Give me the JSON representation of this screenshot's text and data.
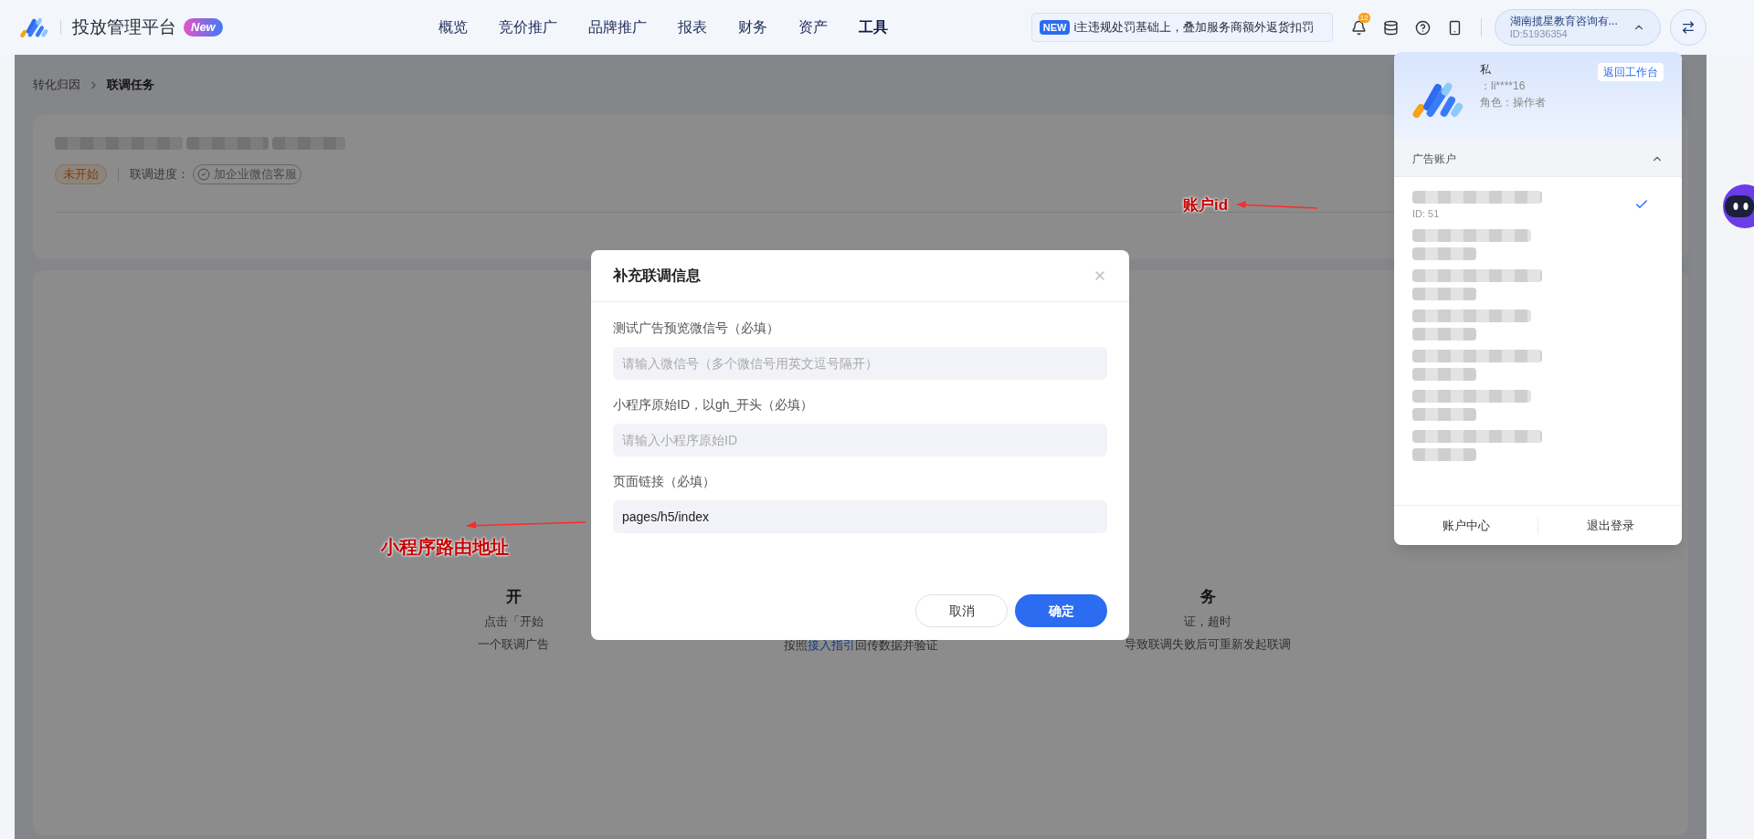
{
  "header": {
    "title": "投放管理平台",
    "badge": "New",
    "nav": [
      {
        "label": "概览",
        "selected": false
      },
      {
        "label": "竞价推广",
        "selected": false
      },
      {
        "label": "品牌推广",
        "selected": false
      },
      {
        "label": "报表",
        "selected": false
      },
      {
        "label": "财务",
        "selected": false
      },
      {
        "label": "资产",
        "selected": false
      },
      {
        "label": "工具",
        "selected": true
      }
    ],
    "notice": {
      "tag": "NEW",
      "text": "i主违规处罚基础上，叠加服务商额外返货扣罚"
    },
    "notification_count": "12",
    "account": {
      "name": "湖南揽星教育咨询有...",
      "id": "ID:51936354",
      "expanded": true
    }
  },
  "breadcrumb": [
    {
      "label": "转化归因",
      "current": false
    },
    {
      "label": "联调任务",
      "current": true
    }
  ],
  "task": {
    "status": "未开始",
    "progress_label": "联调进度：",
    "progress_step": "加企业微信客服",
    "step_done": true
  },
  "steps": [
    {
      "title": "开",
      "lines": [
        [
          {
            "text": "点击「开始"
          }
        ],
        [
          {
            "text": "一个联调广告"
          }
        ]
      ]
    },
    {
      "lines": [
        [
          {
            "text": "按照"
          },
          {
            "text": "接入指引",
            "kind": "link"
          },
          {
            "text": "回传数据并验证"
          }
        ]
      ]
    },
    {
      "title": "务",
      "lines": [
        [
          {
            "text": "证，超时"
          }
        ],
        [
          {
            "text": "导致联调失败后可重新发起联调"
          }
        ]
      ]
    }
  ],
  "dialog": {
    "title": "补充联调信息",
    "fields": [
      {
        "label": "测试广告预览微信号（必填）",
        "placeholder": "请输入微信号（多个微信号用英文逗号隔开）"
      },
      {
        "label": "小程序原始ID，以gh_开头（必填）",
        "placeholder": "请输入小程序原始ID"
      },
      {
        "label": "页面链接（必填）",
        "value": "pages/h5/index"
      }
    ],
    "buttons": [
      {
        "label": "取消",
        "kind": "secondary"
      },
      {
        "label": "确定",
        "kind": "primary"
      }
    ]
  },
  "account_menu": {
    "user_name": "私",
    "login": "：li****16",
    "role": "角色：操作者",
    "back_button": "返回工作台",
    "section": {
      "title": "广告账户",
      "expanded": true
    },
    "accounts": [
      {
        "id_text": "ID: 51",
        "selected": true
      },
      {
        "selected": false
      },
      {
        "selected": false
      },
      {
        "selected": false
      },
      {
        "selected": false
      },
      {
        "selected": false
      },
      {
        "selected": false
      }
    ],
    "footer": [
      "账户中心",
      "退出登录"
    ]
  },
  "annotations": [
    {
      "text": "账户id",
      "kind": "account"
    },
    {
      "text": "小程序路由地址",
      "kind": "route"
    }
  ]
}
